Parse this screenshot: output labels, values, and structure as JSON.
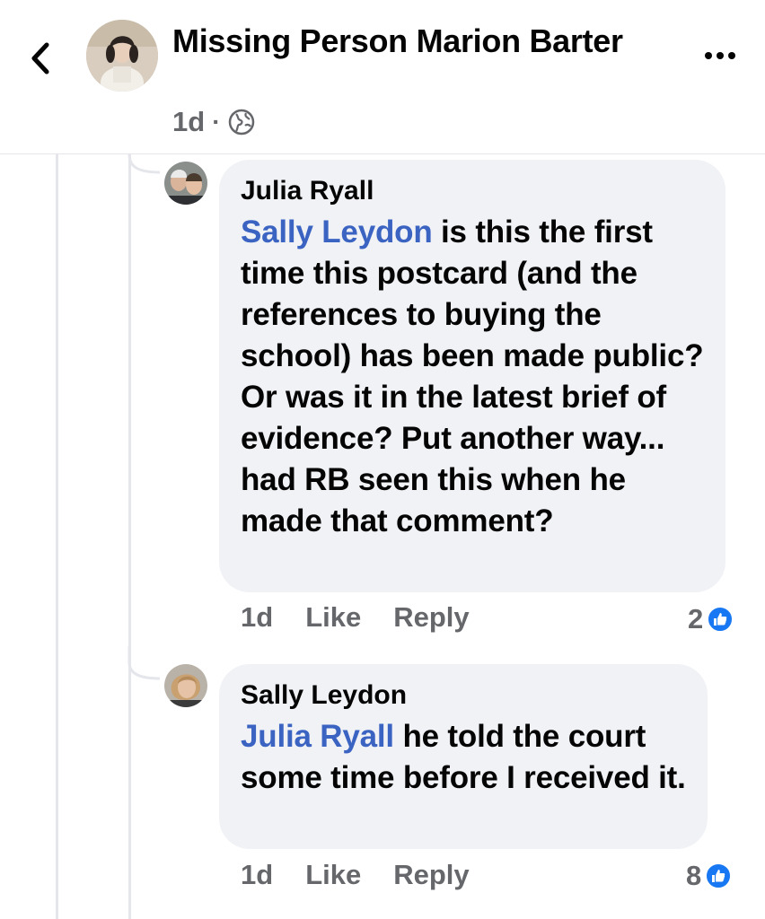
{
  "header": {
    "title": "Missing Person Marion Barter",
    "time": "1d",
    "separator": "·",
    "back_icon": "chevron-left-icon",
    "privacy_icon": "globe-icon",
    "more_icon": "more-horizontal-icon"
  },
  "comments": [
    {
      "author": "Julia Ryall",
      "mention": "Sally Leydon",
      "text": " is this the first time this postcard (and the references to buying the school) has been made public? Or was it in the latest brief of evidence? Put another way... had RB seen this when he made that comment?",
      "time": "1d",
      "like_label": "Like",
      "reply_label": "Reply",
      "reaction_count": "2"
    },
    {
      "author": "Sally Leydon",
      "mention": "Julia Ryall",
      "text": " he told the court some time before I received it.",
      "time": "1d",
      "like_label": "Like",
      "reply_label": "Reply",
      "reaction_count": "8"
    }
  ],
  "colors": {
    "mention": "#3a63c2",
    "bubble": "#f0f2f5",
    "like_badge": "#1877f2",
    "meta": "#65676b"
  }
}
